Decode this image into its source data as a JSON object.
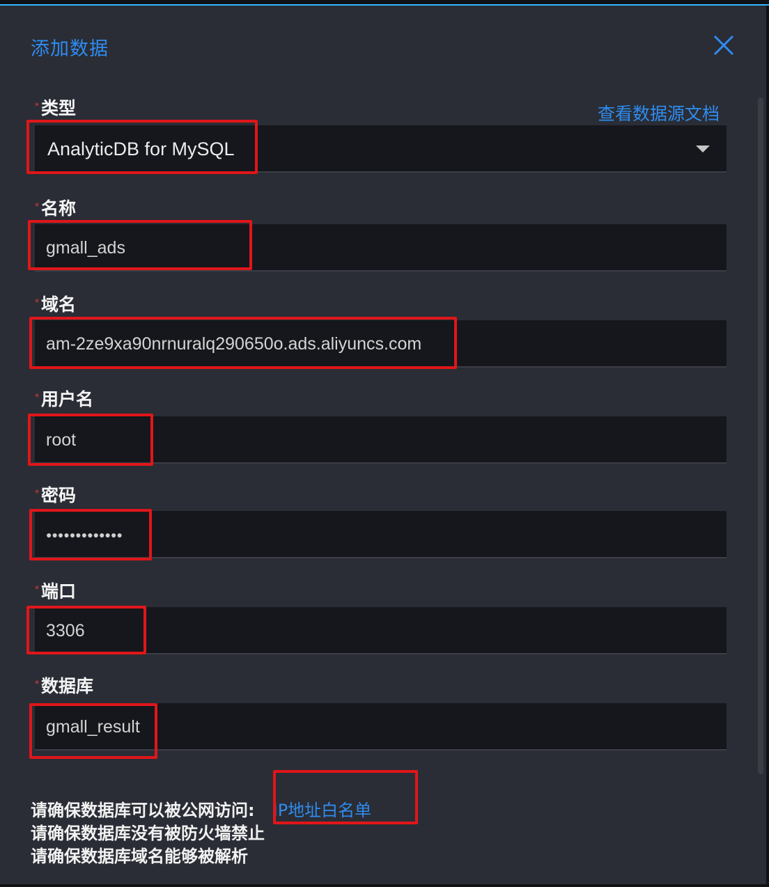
{
  "dialog": {
    "title": "添加数据",
    "close_icon": "close-icon",
    "doc_link": "查看数据源文档",
    "accent_color": "#2f8cf0",
    "required_mark": "*"
  },
  "form": {
    "type": {
      "label": "类型",
      "value": "AnalyticDB for MySQL",
      "dropdown_icon": "caret-down-icon"
    },
    "name": {
      "label": "名称",
      "value": "gmall_ads"
    },
    "domain": {
      "label": "域名",
      "value": "am-2ze9xa90nrnuralq290650o.ads.aliyuncs.com"
    },
    "username": {
      "label": "用户名",
      "value": "root"
    },
    "password": {
      "label": "密码",
      "value": "●●●●●●●●●●●●●"
    },
    "port": {
      "label": "端口",
      "value": "3306"
    },
    "database": {
      "label": "数据库",
      "value": "gmall_result"
    }
  },
  "notes": {
    "line1": "请确保数据库可以被公网访问:",
    "line1_link": "IP地址白名单",
    "line2": "请确保数据库没有被防火墙禁止",
    "line3": "请确保数据库域名能够被解析"
  }
}
